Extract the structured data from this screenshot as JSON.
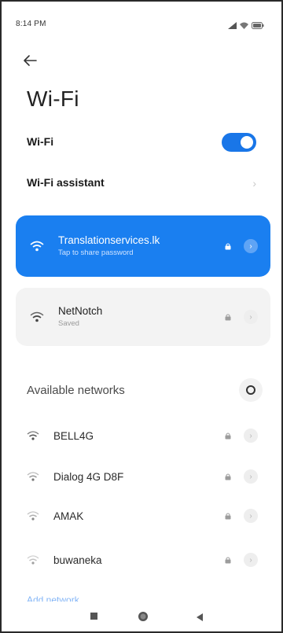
{
  "status_bar": {
    "time": "8:14 PM",
    "icons": [
      "signal-icon",
      "wifi-icon",
      "battery-icon"
    ]
  },
  "header": {
    "back_icon": "back-arrow-icon",
    "title": "Wi-Fi"
  },
  "settings": {
    "wifi_label": "Wi-Fi",
    "wifi_enabled": true,
    "assistant_label": "Wi-Fi assistant"
  },
  "connected_network": {
    "ssid": "Translationservices.lk",
    "subtitle": "Tap to share password",
    "secured": true
  },
  "saved_network": {
    "ssid": "NetNotch",
    "subtitle": "Saved",
    "secured": true
  },
  "available": {
    "title": "Available networks",
    "networks": [
      {
        "ssid": "BELL4G",
        "secured": true
      },
      {
        "ssid": "Dialog 4G D8F",
        "secured": true
      },
      {
        "ssid": "AMAK",
        "secured": true
      },
      {
        "ssid": "buwaneka",
        "secured": true
      }
    ],
    "add_label": "Add network"
  },
  "nav": {
    "icons": [
      "recents-icon",
      "home-icon",
      "back-icon"
    ]
  },
  "colors": {
    "accent": "#1a7ff0",
    "toggle_on": "#1976e8",
    "saved_card": "#f3f3f3"
  }
}
